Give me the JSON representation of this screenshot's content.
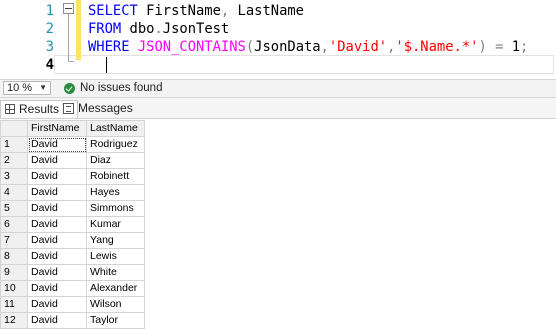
{
  "editor": {
    "line_numbers": [
      "1",
      "2",
      "3",
      "4"
    ],
    "lines": [
      [
        {
          "t": "SELECT",
          "c": "kw"
        },
        {
          "t": " FirstName",
          "c": "txt"
        },
        {
          "t": ",",
          "c": "op"
        },
        {
          "t": " LastName",
          "c": "txt"
        }
      ],
      [
        {
          "t": "FROM",
          "c": "kw"
        },
        {
          "t": " dbo",
          "c": "txt"
        },
        {
          "t": ".",
          "c": "op"
        },
        {
          "t": "JsonTest",
          "c": "txt"
        }
      ],
      [
        {
          "t": "WHERE",
          "c": "kw"
        },
        {
          "t": " JSON_CONTAINS",
          "c": "fn"
        },
        {
          "t": "(",
          "c": "op"
        },
        {
          "t": "JsonData",
          "c": "txt"
        },
        {
          "t": ",",
          "c": "op"
        },
        {
          "t": "'David'",
          "c": "str"
        },
        {
          "t": ",",
          "c": "op"
        },
        {
          "t": "'$.Name.*'",
          "c": "str"
        },
        {
          "t": ")",
          "c": "op"
        },
        {
          "t": " ",
          "c": "txt"
        },
        {
          "t": "=",
          "c": "op"
        },
        {
          "t": " 1",
          "c": "txt"
        },
        {
          "t": ";",
          "c": "op"
        }
      ],
      []
    ]
  },
  "status": {
    "zoom": "10 %",
    "issues": "No issues found"
  },
  "tabs": {
    "results": "Results",
    "messages": "Messages"
  },
  "grid": {
    "columns": [
      "FirstName",
      "LastName"
    ],
    "rows": [
      [
        "1",
        "David",
        "Rodriguez"
      ],
      [
        "2",
        "David",
        "Diaz"
      ],
      [
        "3",
        "David",
        "Robinett"
      ],
      [
        "4",
        "David",
        "Hayes"
      ],
      [
        "5",
        "David",
        "Simmons"
      ],
      [
        "6",
        "David",
        "Kumar"
      ],
      [
        "7",
        "David",
        "Yang"
      ],
      [
        "8",
        "David",
        "Lewis"
      ],
      [
        "9",
        "David",
        "White"
      ],
      [
        "10",
        "David",
        "Alexander"
      ],
      [
        "11",
        "David",
        "Wilson"
      ],
      [
        "12",
        "David",
        "Taylor"
      ]
    ]
  }
}
